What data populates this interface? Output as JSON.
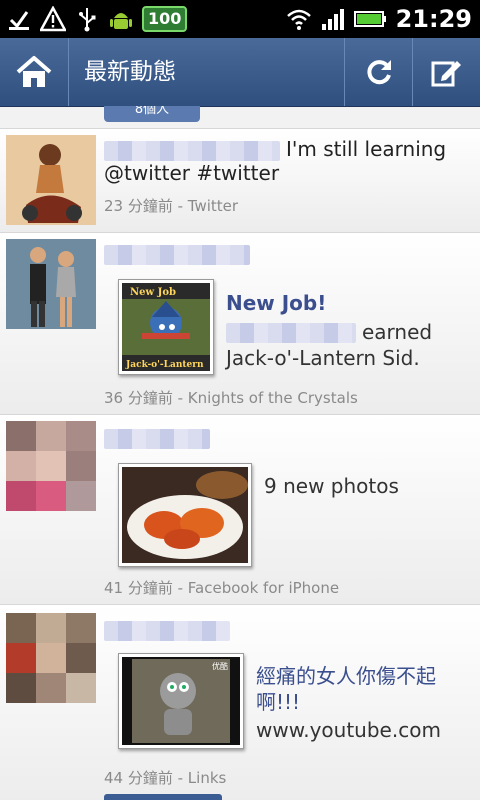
{
  "status_bar": {
    "battery": "100",
    "time": "21:29"
  },
  "action_bar": {
    "title": "最新動態"
  },
  "feed": {
    "peek_chip": "8個人",
    "stories": [
      {
        "text_line1": "I'm still learning",
        "text_line2": "@twitter #twitter",
        "meta": "23 分鐘前 - Twitter"
      },
      {
        "attachment_title": "New Job!",
        "attachment_desc_line1": "earned",
        "attachment_desc_line2": "Jack-o'-Lantern Sid.",
        "thumb_caption_top": "New Job",
        "thumb_caption_bottom": "Jack-o'-Lantern",
        "meta": "36 分鐘前 - Knights of the Crystals"
      },
      {
        "attachment_title": "9 new photos",
        "meta": "41 分鐘前 - Facebook for iPhone"
      },
      {
        "attachment_title_line1": "經痛的女人你傷不起",
        "attachment_title_line2": "啊!!!",
        "attachment_desc": "www.youtube.com",
        "thumb_badge": "优酷",
        "meta": "44 分鐘前 - Links"
      }
    ]
  }
}
